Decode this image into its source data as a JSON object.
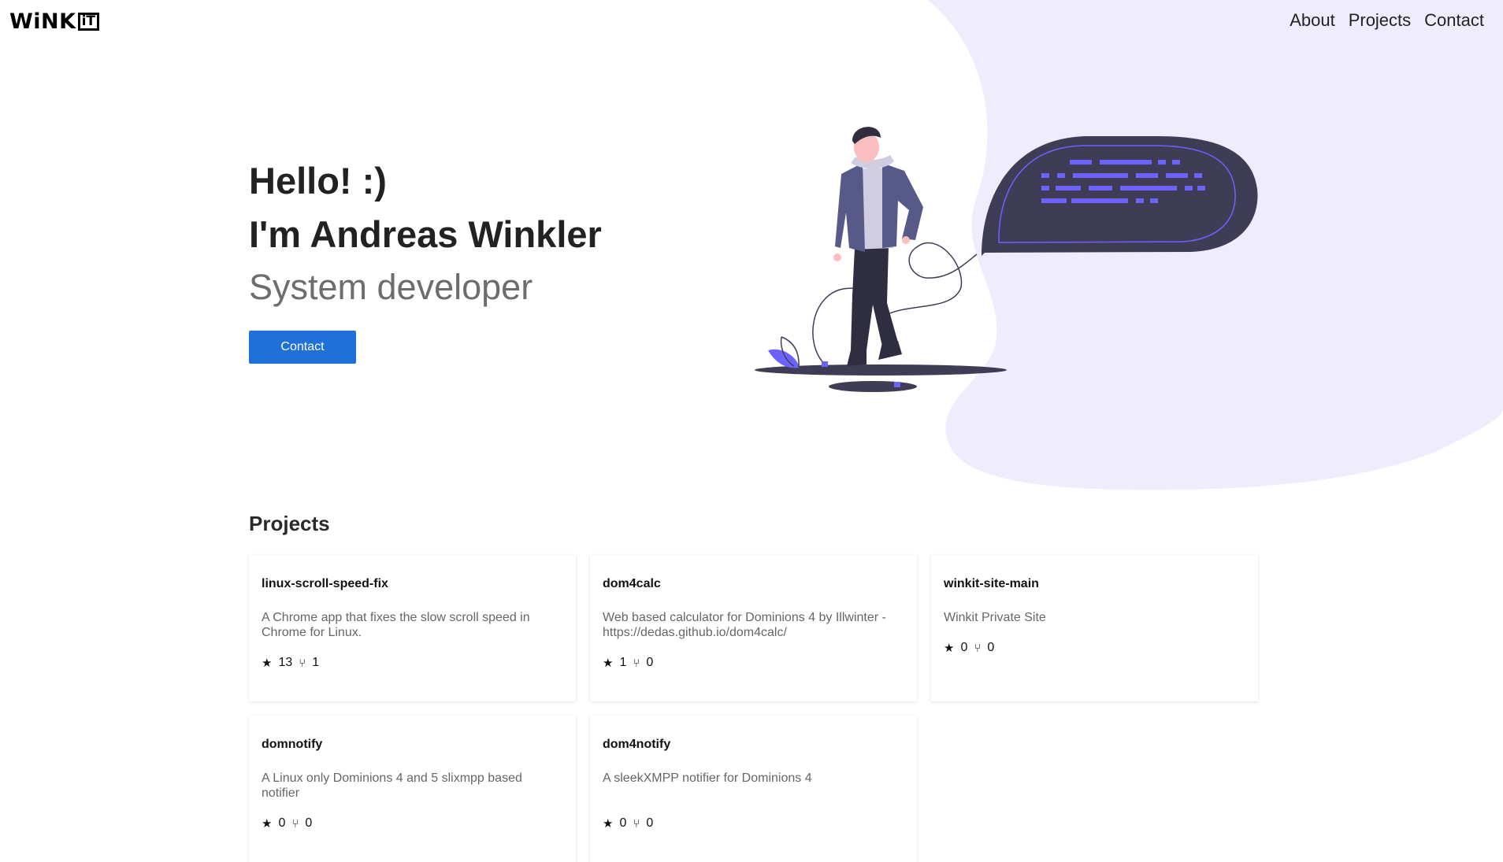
{
  "brand": {
    "logo_text": "WiNK",
    "logo_box_text": "iT"
  },
  "nav": {
    "items": [
      "About",
      "Projects",
      "Contact"
    ]
  },
  "hero": {
    "greeting": "Hello! :)",
    "name_line": "I'm Andreas Winkler",
    "role": "System developer",
    "cta_label": "Contact"
  },
  "colors": {
    "accent_blue": "#1f70d9",
    "blob_lavender": "#efedfd",
    "illustration_purple": "#6c63ff",
    "illustration_dark": "#3f3d56"
  },
  "projects": {
    "title": "Projects",
    "items": [
      {
        "name": "linux-scroll-speed-fix",
        "description": "A Chrome app that fixes the slow scroll speed in Chrome for Linux.",
        "stars": "13",
        "forks": "1"
      },
      {
        "name": "dom4calc",
        "description": "Web based calculator for Dominions 4 by Illwinter - https://dedas.github.io/dom4calc/",
        "stars": "1",
        "forks": "0"
      },
      {
        "name": "winkit-site-main",
        "description": "Winkit Private Site",
        "stars": "0",
        "forks": "0"
      },
      {
        "name": "domnotify",
        "description": "A Linux only Dominions 4 and 5 slixmpp based notifier",
        "stars": "0",
        "forks": "0"
      },
      {
        "name": "dom4notify",
        "description": "A sleekXMPP notifier for Dominions 4",
        "stars": "0",
        "forks": "0"
      }
    ]
  }
}
